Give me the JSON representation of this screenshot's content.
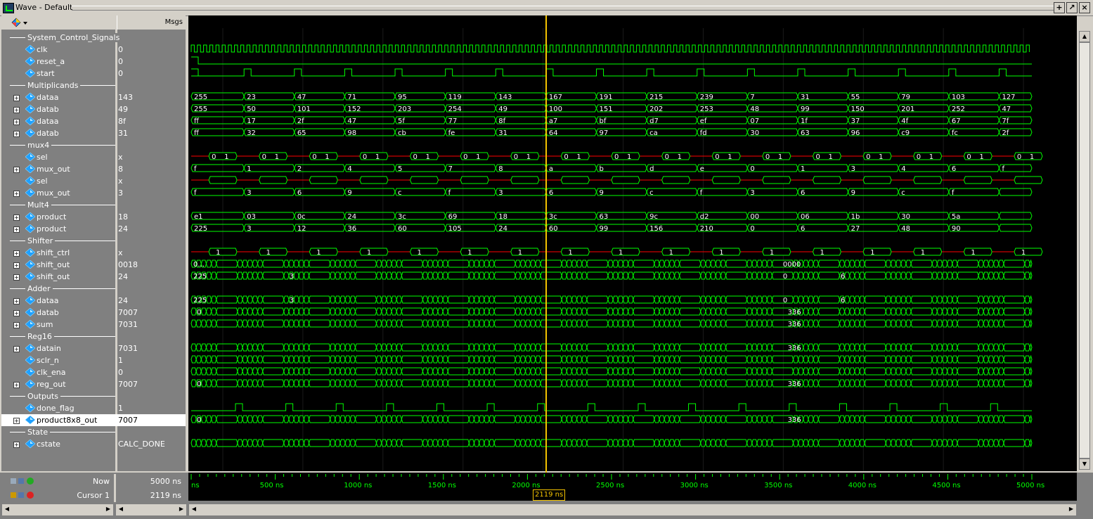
{
  "window": {
    "title": "Wave - Default",
    "grip": ":::::::"
  },
  "header": {
    "msgs": "Msgs"
  },
  "rows": [
    {
      "type": "group",
      "label": "System_Control_Signals"
    },
    {
      "type": "sig",
      "label": "clk",
      "value": "0",
      "expand": false
    },
    {
      "type": "sig",
      "label": "reset_a",
      "value": "0",
      "expand": false
    },
    {
      "type": "sig",
      "label": "start",
      "value": "0",
      "expand": false
    },
    {
      "type": "group",
      "label": "Multiplicands"
    },
    {
      "type": "sig",
      "label": "dataa",
      "value": "143",
      "expand": true
    },
    {
      "type": "sig",
      "label": "datab",
      "value": "49",
      "expand": true
    },
    {
      "type": "sig",
      "label": "dataa",
      "value": "8f",
      "expand": true
    },
    {
      "type": "sig",
      "label": "datab",
      "value": "31",
      "expand": true
    },
    {
      "type": "group",
      "label": "mux4"
    },
    {
      "type": "sig",
      "label": "sel",
      "value": "x",
      "expand": false
    },
    {
      "type": "sig",
      "label": "mux_out",
      "value": "8",
      "expand": true
    },
    {
      "type": "sig",
      "label": "sel",
      "value": "x",
      "expand": false
    },
    {
      "type": "sig",
      "label": "mux_out",
      "value": "3",
      "expand": true
    },
    {
      "type": "group",
      "label": "Mult4"
    },
    {
      "type": "sig",
      "label": "product",
      "value": "18",
      "expand": true
    },
    {
      "type": "sig",
      "label": "product",
      "value": "24",
      "expand": true
    },
    {
      "type": "group",
      "label": "Shifter"
    },
    {
      "type": "sig",
      "label": "shift_ctrl",
      "value": "x",
      "expand": true
    },
    {
      "type": "sig",
      "label": "shift_out",
      "value": "0018",
      "expand": true
    },
    {
      "type": "sig",
      "label": "shift_out",
      "value": "24",
      "expand": true
    },
    {
      "type": "group",
      "label": "Adder"
    },
    {
      "type": "sig",
      "label": "dataa",
      "value": "24",
      "expand": true
    },
    {
      "type": "sig",
      "label": "datab",
      "value": "7007",
      "expand": true
    },
    {
      "type": "sig",
      "label": "sum",
      "value": "7031",
      "expand": true
    },
    {
      "type": "group",
      "label": "Reg16"
    },
    {
      "type": "sig",
      "label": "datain",
      "value": "7031",
      "expand": true
    },
    {
      "type": "sig",
      "label": "sclr_n",
      "value": "1",
      "expand": false
    },
    {
      "type": "sig",
      "label": "clk_ena",
      "value": "0",
      "expand": false
    },
    {
      "type": "sig",
      "label": "reg_out",
      "value": "7007",
      "expand": true
    },
    {
      "type": "group",
      "label": "Outputs"
    },
    {
      "type": "sig",
      "label": "done_flag",
      "value": "1",
      "expand": false
    },
    {
      "type": "sig",
      "label": "product8x8_out",
      "value": "7007",
      "expand": true,
      "selected": true
    },
    {
      "type": "group",
      "label": "State"
    },
    {
      "type": "sig",
      "label": "cstate",
      "value": "CALC_DONE",
      "expand": true
    }
  ],
  "waves": {
    "dataa_dec": [
      "255",
      "23",
      "47",
      "71",
      "95",
      "119",
      "143",
      "167",
      "191",
      "215",
      "239",
      "7",
      "31",
      "55",
      "79",
      "103",
      "127"
    ],
    "datab_dec": [
      "255",
      "50",
      "101",
      "152",
      "203",
      "254",
      "49",
      "100",
      "151",
      "202",
      "253",
      "48",
      "99",
      "150",
      "201",
      "252",
      "47"
    ],
    "dataa_hex": [
      "ff",
      "17",
      "2f",
      "47",
      "5f",
      "77",
      "8f",
      "a7",
      "bf",
      "d7",
      "ef",
      "07",
      "1f",
      "37",
      "4f",
      "67",
      "7f"
    ],
    "datab_hex": [
      "ff",
      "32",
      "65",
      "98",
      "cb",
      "fe",
      "31",
      "64",
      "97",
      "ca",
      "fd",
      "30",
      "63",
      "96",
      "c9",
      "fc",
      "2f"
    ],
    "mux_out_a": [
      "f",
      "1",
      "2",
      "4",
      "5",
      "7",
      "8",
      "a",
      "b",
      "d",
      "e",
      "0",
      "1",
      "3",
      "4",
      "6",
      "f"
    ],
    "mux_out_b": [
      "f",
      "3",
      "6",
      "9",
      "c",
      "f",
      "3",
      "6",
      "9",
      "c",
      "f",
      "3",
      "6",
      "9",
      "c",
      "f",
      ""
    ],
    "product_hex": [
      "e1",
      "03",
      "0c",
      "24",
      "3c",
      "69",
      "18",
      "3c",
      "63",
      "9c",
      "d2",
      "00",
      "06",
      "1b",
      "30",
      "5a",
      ""
    ],
    "product_dec": [
      "225",
      "3",
      "12",
      "36",
      "60",
      "105",
      "24",
      "60",
      "99",
      "156",
      "210",
      "0",
      "6",
      "27",
      "48",
      "90",
      ""
    ],
    "shift_out_hex": "0...",
    "shift_out_mid": "0000",
    "shift_out_dec_start": "225",
    "shift_out_dec_a": "3",
    "shift_out_dec_b": "0",
    "shift_out_dec_c": "6",
    "adder_dataa_start": "225",
    "datab_start": "0",
    "sum_val": "336",
    "reg_out_val": "336",
    "product8x8_val": "336"
  },
  "timeline": {
    "now_label": "Now",
    "now_value": "5000 ns",
    "cursor_label": "Cursor 1",
    "cursor_value": "2119 ns",
    "cursor_flag": "2119 ns",
    "ticks": [
      "ns",
      "500 ns",
      "1000 ns",
      "1500 ns",
      "2000 ns",
      "2500 ns",
      "3000 ns",
      "3500 ns",
      "4000 ns",
      "4500 ns",
      "5000 ns"
    ]
  },
  "colors": {
    "wave": "#00ff00",
    "xstate": "#ff0000",
    "cursor": "#f5c400",
    "text": "#ffffff"
  }
}
